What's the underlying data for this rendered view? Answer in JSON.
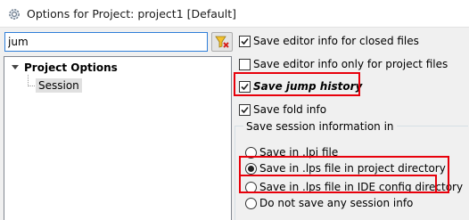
{
  "window": {
    "title": "Options for Project: project1 [Default]",
    "icon": "gear-icon"
  },
  "filter": {
    "value": "jum",
    "clear_icon": "clear-filter-icon"
  },
  "tree": {
    "root_label": "Project Options",
    "expander_icon": "tree-collapse-arrow-icon",
    "items": [
      {
        "label": "Session",
        "selected": true
      }
    ]
  },
  "options": [
    {
      "label": "Save editor info for closed files",
      "checked": true,
      "highlighted": false,
      "bold_italic": false
    },
    {
      "label": "Save editor info only for project files",
      "checked": false,
      "highlighted": false,
      "bold_italic": false
    },
    {
      "label": "Save jump history",
      "checked": true,
      "highlighted": true,
      "bold_italic": true
    },
    {
      "label": "Save fold info",
      "checked": true,
      "highlighted": false,
      "bold_italic": false
    }
  ],
  "session_group": {
    "title": "Save session information in",
    "radios": [
      {
        "label": "Save in .lpi file",
        "selected": false,
        "highlighted": false
      },
      {
        "label": "Save in .lps file in project directory",
        "selected": true,
        "highlighted": true
      },
      {
        "label": "Save in .lps file in IDE config directory",
        "selected": false,
        "highlighted": true
      },
      {
        "label": "Do not save any session info",
        "selected": false,
        "highlighted": false
      }
    ]
  },
  "colors": {
    "highlight": "#e8000b",
    "focus_border": "#2f7ed8",
    "selection": "#e0e0e0"
  }
}
